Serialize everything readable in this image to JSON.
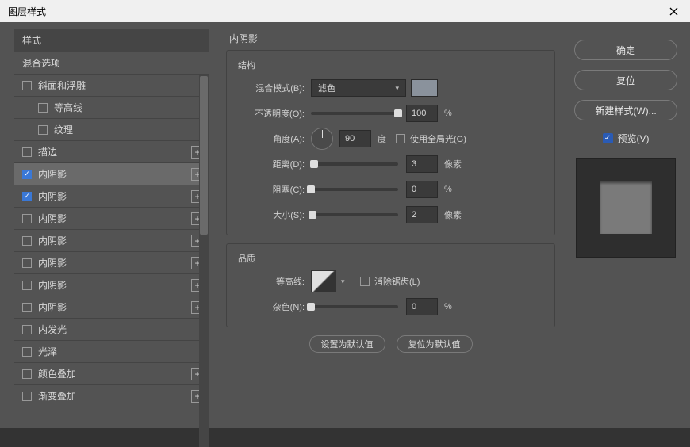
{
  "window": {
    "title": "图层样式"
  },
  "left": {
    "header": "样式",
    "blend_options": "混合选项",
    "items": [
      {
        "label": "斜面和浮雕",
        "checked": false,
        "indent": false,
        "plus": false
      },
      {
        "label": "等高线",
        "checked": false,
        "indent": true,
        "plus": false
      },
      {
        "label": "纹理",
        "checked": false,
        "indent": true,
        "plus": false
      },
      {
        "label": "描边",
        "checked": false,
        "indent": false,
        "plus": true
      },
      {
        "label": "内阴影",
        "checked": true,
        "indent": false,
        "plus": true,
        "selected": true
      },
      {
        "label": "内阴影",
        "checked": true,
        "indent": false,
        "plus": true
      },
      {
        "label": "内阴影",
        "checked": false,
        "indent": false,
        "plus": true
      },
      {
        "label": "内阴影",
        "checked": false,
        "indent": false,
        "plus": true
      },
      {
        "label": "内阴影",
        "checked": false,
        "indent": false,
        "plus": true
      },
      {
        "label": "内阴影",
        "checked": false,
        "indent": false,
        "plus": true
      },
      {
        "label": "内阴影",
        "checked": false,
        "indent": false,
        "plus": true
      },
      {
        "label": "内发光",
        "checked": false,
        "indent": false,
        "plus": false
      },
      {
        "label": "光泽",
        "checked": false,
        "indent": false,
        "plus": false
      },
      {
        "label": "颜色叠加",
        "checked": false,
        "indent": false,
        "plus": true
      },
      {
        "label": "渐变叠加",
        "checked": false,
        "indent": false,
        "plus": true
      }
    ]
  },
  "center": {
    "title": "内阴影",
    "structure": {
      "title": "结构",
      "blend_mode_label": "混合模式(B):",
      "blend_mode_value": "滤色",
      "opacity_label": "不透明度(O):",
      "opacity_value": "100",
      "opacity_unit": "%",
      "angle_label": "角度(A):",
      "angle_value": "90",
      "angle_unit": "度",
      "global_light_label": "使用全局光(G)",
      "distance_label": "距离(D):",
      "distance_value": "3",
      "distance_unit": "像素",
      "choke_label": "阻塞(C):",
      "choke_value": "0",
      "choke_unit": "%",
      "size_label": "大小(S):",
      "size_value": "2",
      "size_unit": "像素"
    },
    "quality": {
      "title": "品质",
      "contour_label": "等高线:",
      "antialias_label": "消除锯齿(L)",
      "noise_label": "杂色(N):",
      "noise_value": "0",
      "noise_unit": "%"
    },
    "set_default": "设置为默认值",
    "reset_default": "复位为默认值"
  },
  "right": {
    "ok": "确定",
    "cancel": "复位",
    "new_style": "新建样式(W)...",
    "preview_label": "预览(V)"
  }
}
